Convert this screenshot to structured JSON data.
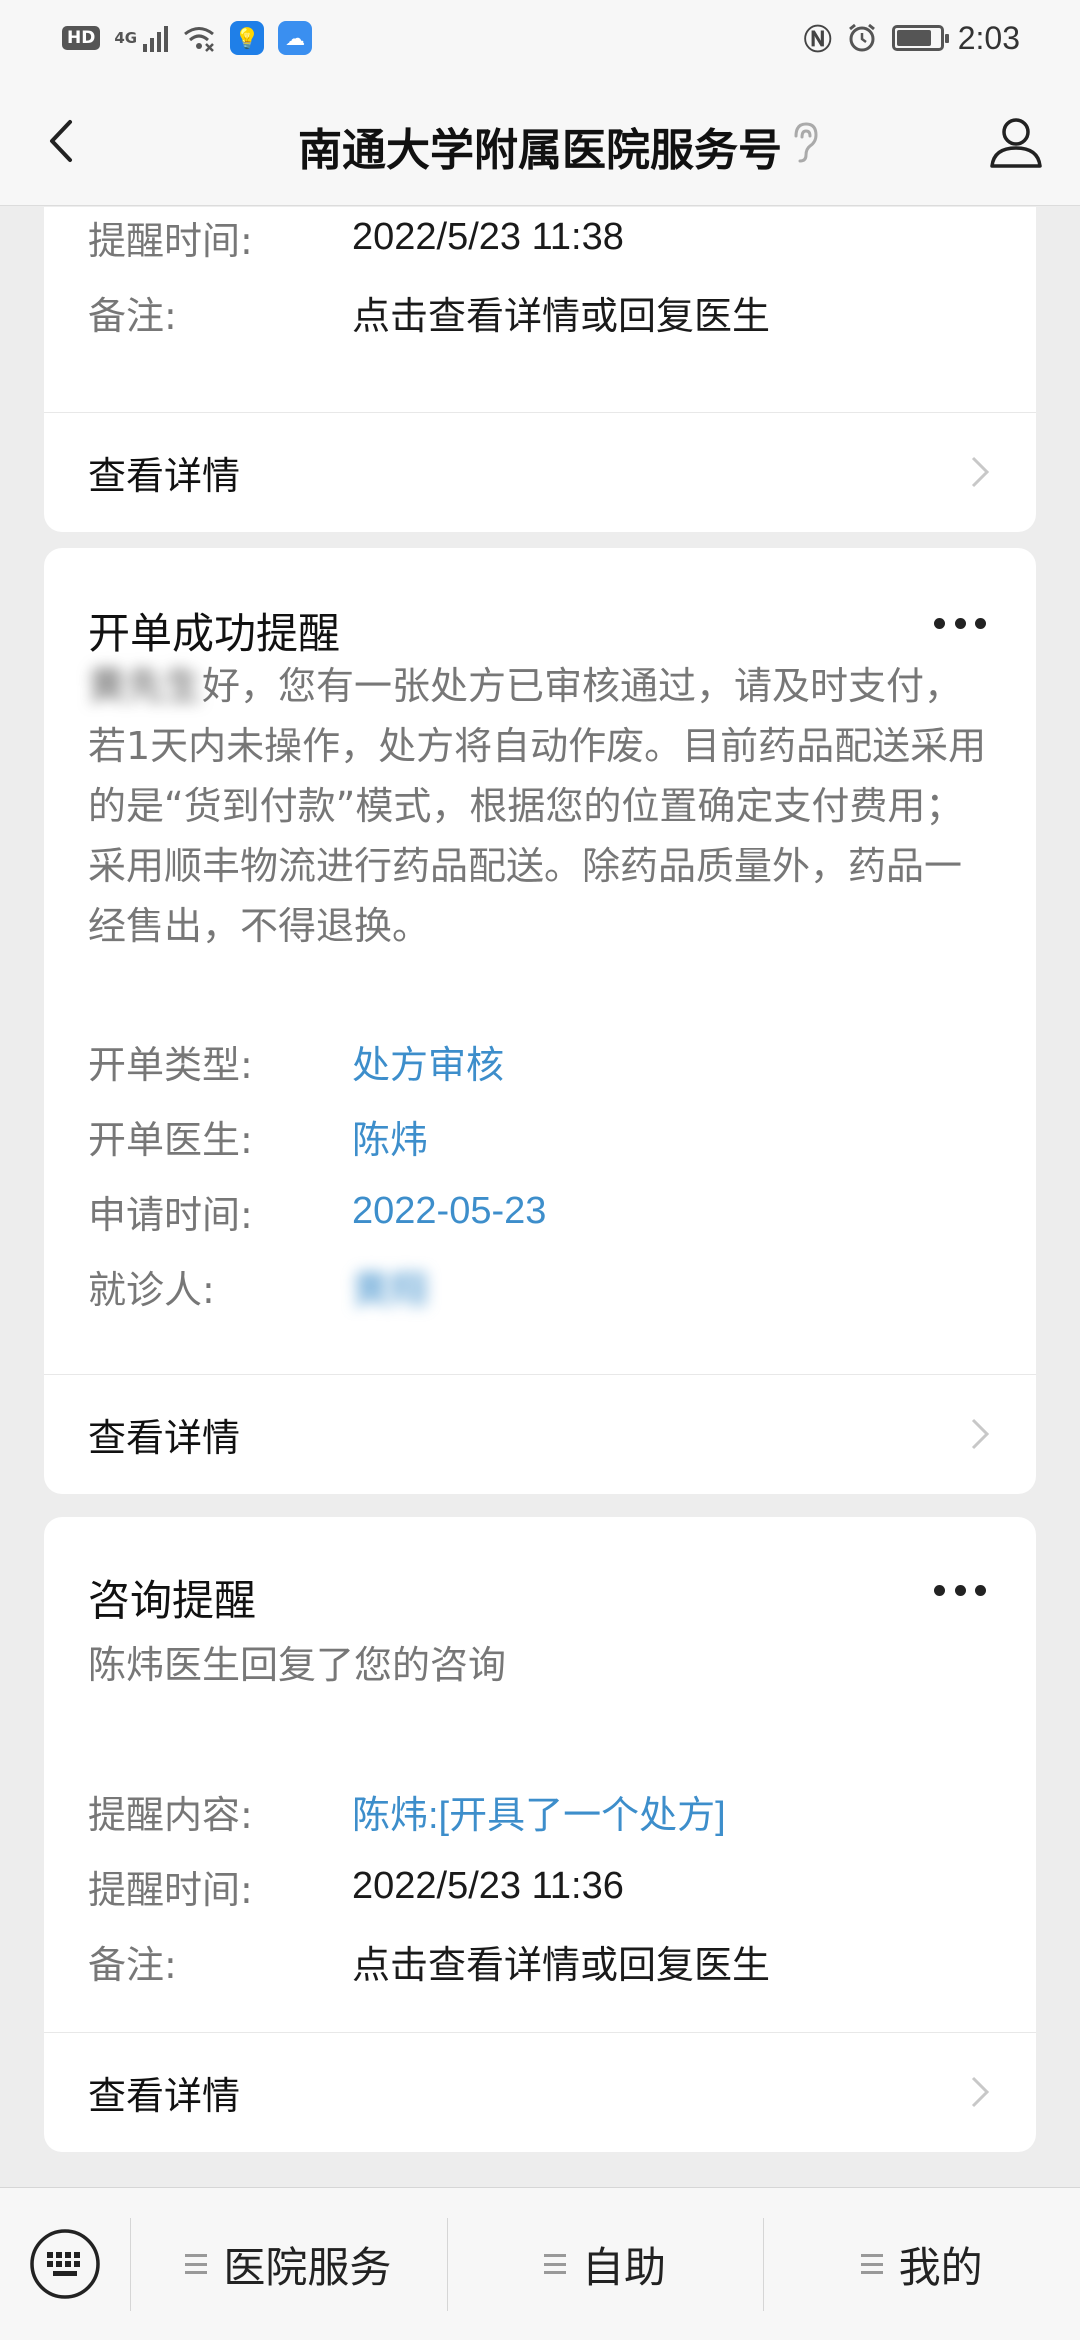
{
  "status_bar": {
    "hd": "HD",
    "network": "4G",
    "time": "2:03",
    "battery_level": 0.8
  },
  "nav": {
    "title": "南通大学附属医院服务号"
  },
  "card1": {
    "fields": [
      {
        "label": "提醒时间:",
        "value": "2022/5/23 11:38"
      },
      {
        "label": "备注:",
        "value": "点击查看详情或回复医生"
      }
    ],
    "detail_label": "查看详情"
  },
  "card2": {
    "title": "开单成功提醒",
    "desc_name": "黄先生",
    "desc_text": "好，您有一张处方已审核通过，请及时支付，若1天内未操作，处方将自动作废。目前药品配送采用的是“货到付款”模式，根据您的位置确定支付费用；采用顺丰物流进行药品配送。除药品质量外，药品一经售出，不得退换。",
    "fields": [
      {
        "label": "开单类型:",
        "value": "处方审核"
      },
      {
        "label": "开单医生:",
        "value": "陈炜"
      },
      {
        "label": "申请时间:",
        "value": "2022-05-23"
      },
      {
        "label": "就诊人:",
        "value": "黄翔"
      }
    ],
    "detail_label": "查看详情"
  },
  "card3": {
    "title": "咨询提醒",
    "desc": "陈炜医生回复了您的咨询",
    "fields": [
      {
        "label": "提醒内容:",
        "value": "陈炜:[开具了一个处方]"
      },
      {
        "label": "提醒时间:",
        "value": "2022/5/23 11:36"
      },
      {
        "label": "备注:",
        "value": "点击查看详情或回复医生"
      }
    ],
    "detail_label": "查看详情"
  },
  "bottom_menu": {
    "items": [
      "医院服务",
      "自助",
      "我的"
    ]
  },
  "colors": {
    "link": "#3d8ecb",
    "background": "#ededed"
  }
}
